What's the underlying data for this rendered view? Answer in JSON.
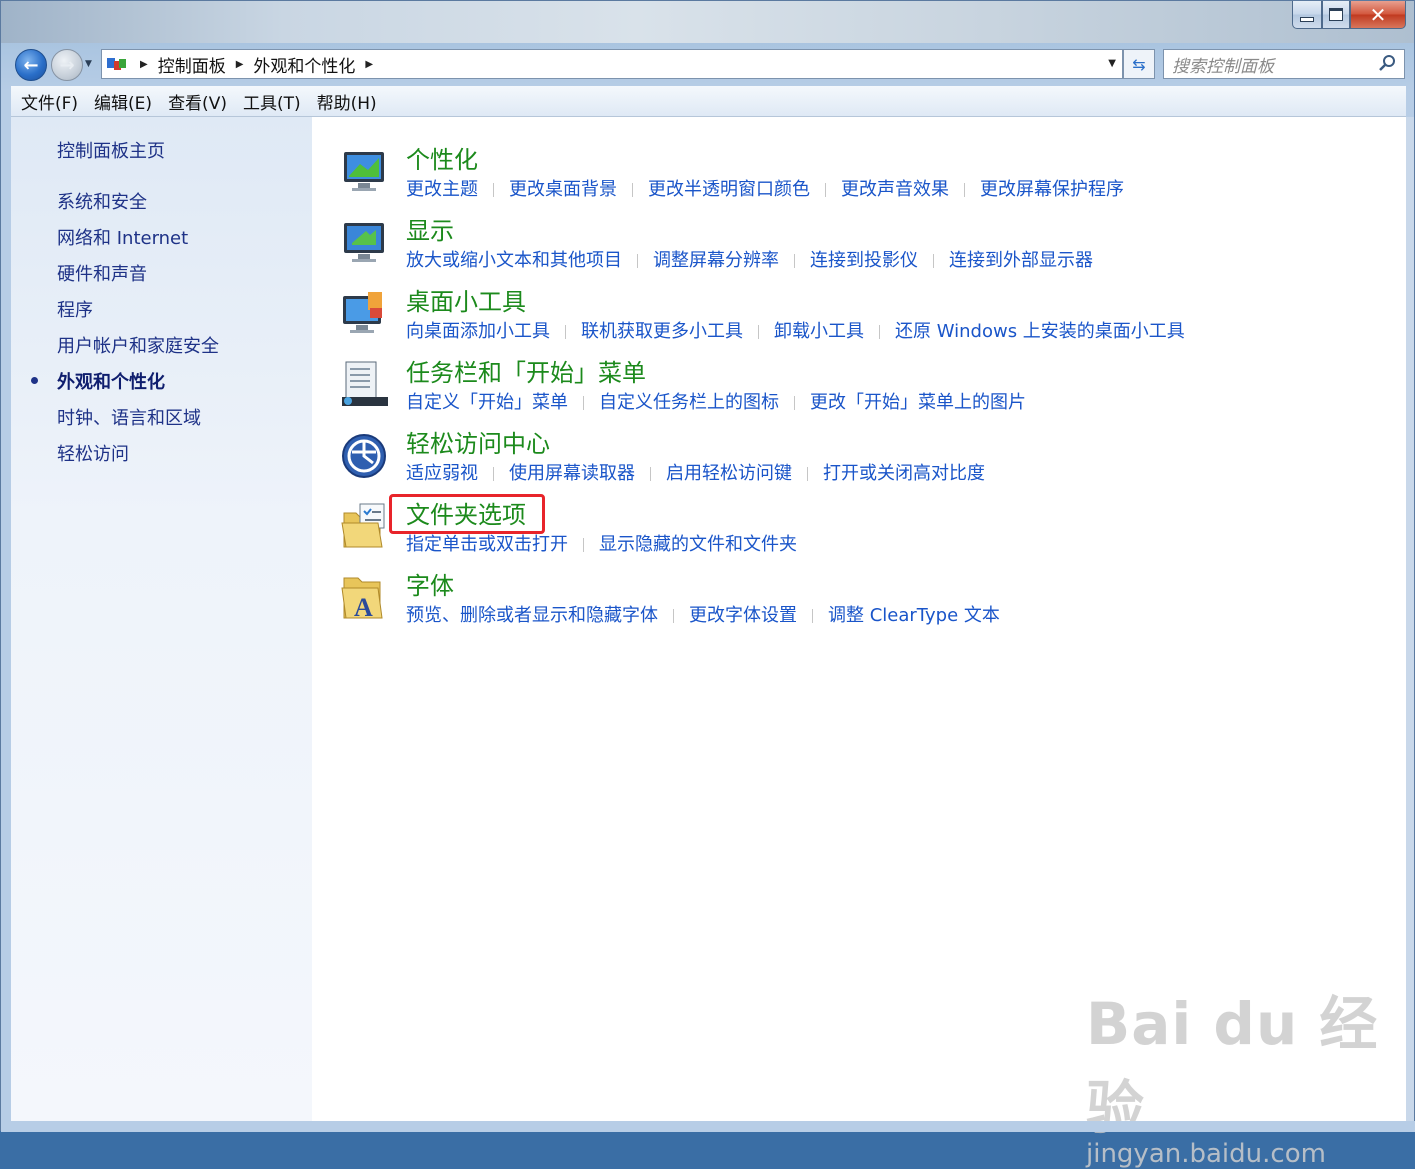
{
  "window": {
    "close_glyph": "✕"
  },
  "nav": {
    "back_glyph": "←",
    "forward_glyph": "→",
    "breadcrumb": [
      "控制面板",
      "外观和个性化"
    ],
    "search_placeholder": "搜索控制面板"
  },
  "menubar": [
    "文件(F)",
    "编辑(E)",
    "查看(V)",
    "工具(T)",
    "帮助(H)"
  ],
  "sidebar": {
    "home": "控制面板主页",
    "items": [
      {
        "label": "系统和安全",
        "active": false
      },
      {
        "label": "网络和 Internet",
        "active": false
      },
      {
        "label": "硬件和声音",
        "active": false
      },
      {
        "label": "程序",
        "active": false
      },
      {
        "label": "用户帐户和家庭安全",
        "active": false
      },
      {
        "label": "外观和个性化",
        "active": true
      },
      {
        "label": "时钟、语言和区域",
        "active": false
      },
      {
        "label": "轻松访问",
        "active": false
      }
    ]
  },
  "categories": [
    {
      "title": "个性化",
      "icon": "personalization-icon",
      "links": [
        "更改主题",
        "更改桌面背景",
        "更改半透明窗口颜色",
        "更改声音效果",
        "更改屏幕保护程序"
      ]
    },
    {
      "title": "显示",
      "icon": "display-icon",
      "links": [
        "放大或缩小文本和其他项目",
        "调整屏幕分辨率",
        "连接到投影仪",
        "连接到外部显示器"
      ]
    },
    {
      "title": "桌面小工具",
      "icon": "gadgets-icon",
      "links": [
        "向桌面添加小工具",
        "联机获取更多小工具",
        "卸载小工具",
        "还原 Windows 上安装的桌面小工具"
      ]
    },
    {
      "title": "任务栏和「开始」菜单",
      "icon": "taskbar-icon",
      "links": [
        "自定义「开始」菜单",
        "自定义任务栏上的图标",
        "更改「开始」菜单上的图片"
      ]
    },
    {
      "title": "轻松访问中心",
      "icon": "ease-of-access-icon",
      "links": [
        "适应弱视",
        "使用屏幕读取器",
        "启用轻松访问键",
        "打开或关闭高对比度"
      ]
    },
    {
      "title": "文件夹选项",
      "icon": "folder-options-icon",
      "highlighted": true,
      "links": [
        "指定单击或双击打开",
        "显示隐藏的文件和文件夹"
      ]
    },
    {
      "title": "字体",
      "icon": "fonts-icon",
      "links": [
        "预览、删除或者显示和隐藏字体",
        "更改字体设置",
        "调整 ClearType 文本"
      ]
    }
  ],
  "colors": {
    "link": "#1a55c9",
    "category_title": "#1c8a1c",
    "highlight_border": "#e8242a"
  },
  "watermark": {
    "logo": "Bai du 经验",
    "url": "jingyan.baidu.com"
  }
}
